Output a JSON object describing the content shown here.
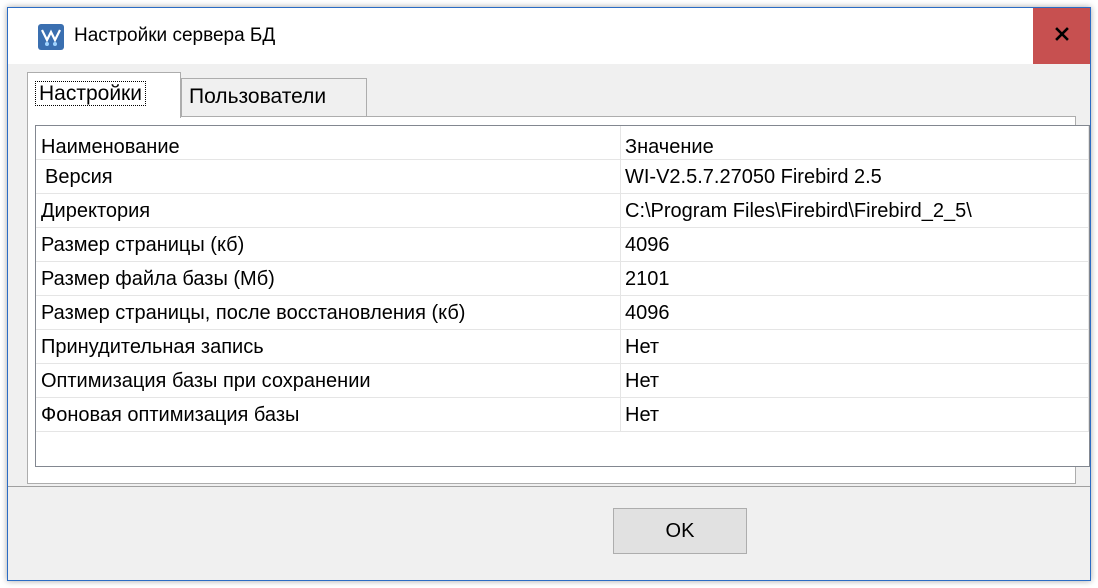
{
  "window": {
    "title": "Настройки сервера БД",
    "close_label": "x",
    "app_icon": "database-server-icon",
    "close_color": "#c75050",
    "border_color": "#2b6cc4"
  },
  "tabs": [
    {
      "label": "Настройки",
      "active": true
    },
    {
      "label": "Пользователи",
      "active": false
    }
  ],
  "grid": {
    "columns": [
      "Наименование",
      "Значение"
    ],
    "rows": [
      {
        "name": "Версия",
        "value": "WI-V2.5.7.27050 Firebird 2.5"
      },
      {
        "name": "Директория",
        "value": "C:\\Program Files\\Firebird\\Firebird_2_5\\"
      },
      {
        "name": "Размер страницы (кб)",
        "value": "4096"
      },
      {
        "name": "Размер файла базы (Мб)",
        "value": "2101"
      },
      {
        "name": "Размер страницы, после восстановления (кб)",
        "value": "4096"
      },
      {
        "name": "Принудительная запись",
        "value": "Нет"
      },
      {
        "name": "Оптимизация базы при сохранении",
        "value": "Нет"
      },
      {
        "name": "Фоновая оптимизация базы",
        "value": "Нет"
      }
    ]
  },
  "footer": {
    "ok_label": "OK"
  }
}
